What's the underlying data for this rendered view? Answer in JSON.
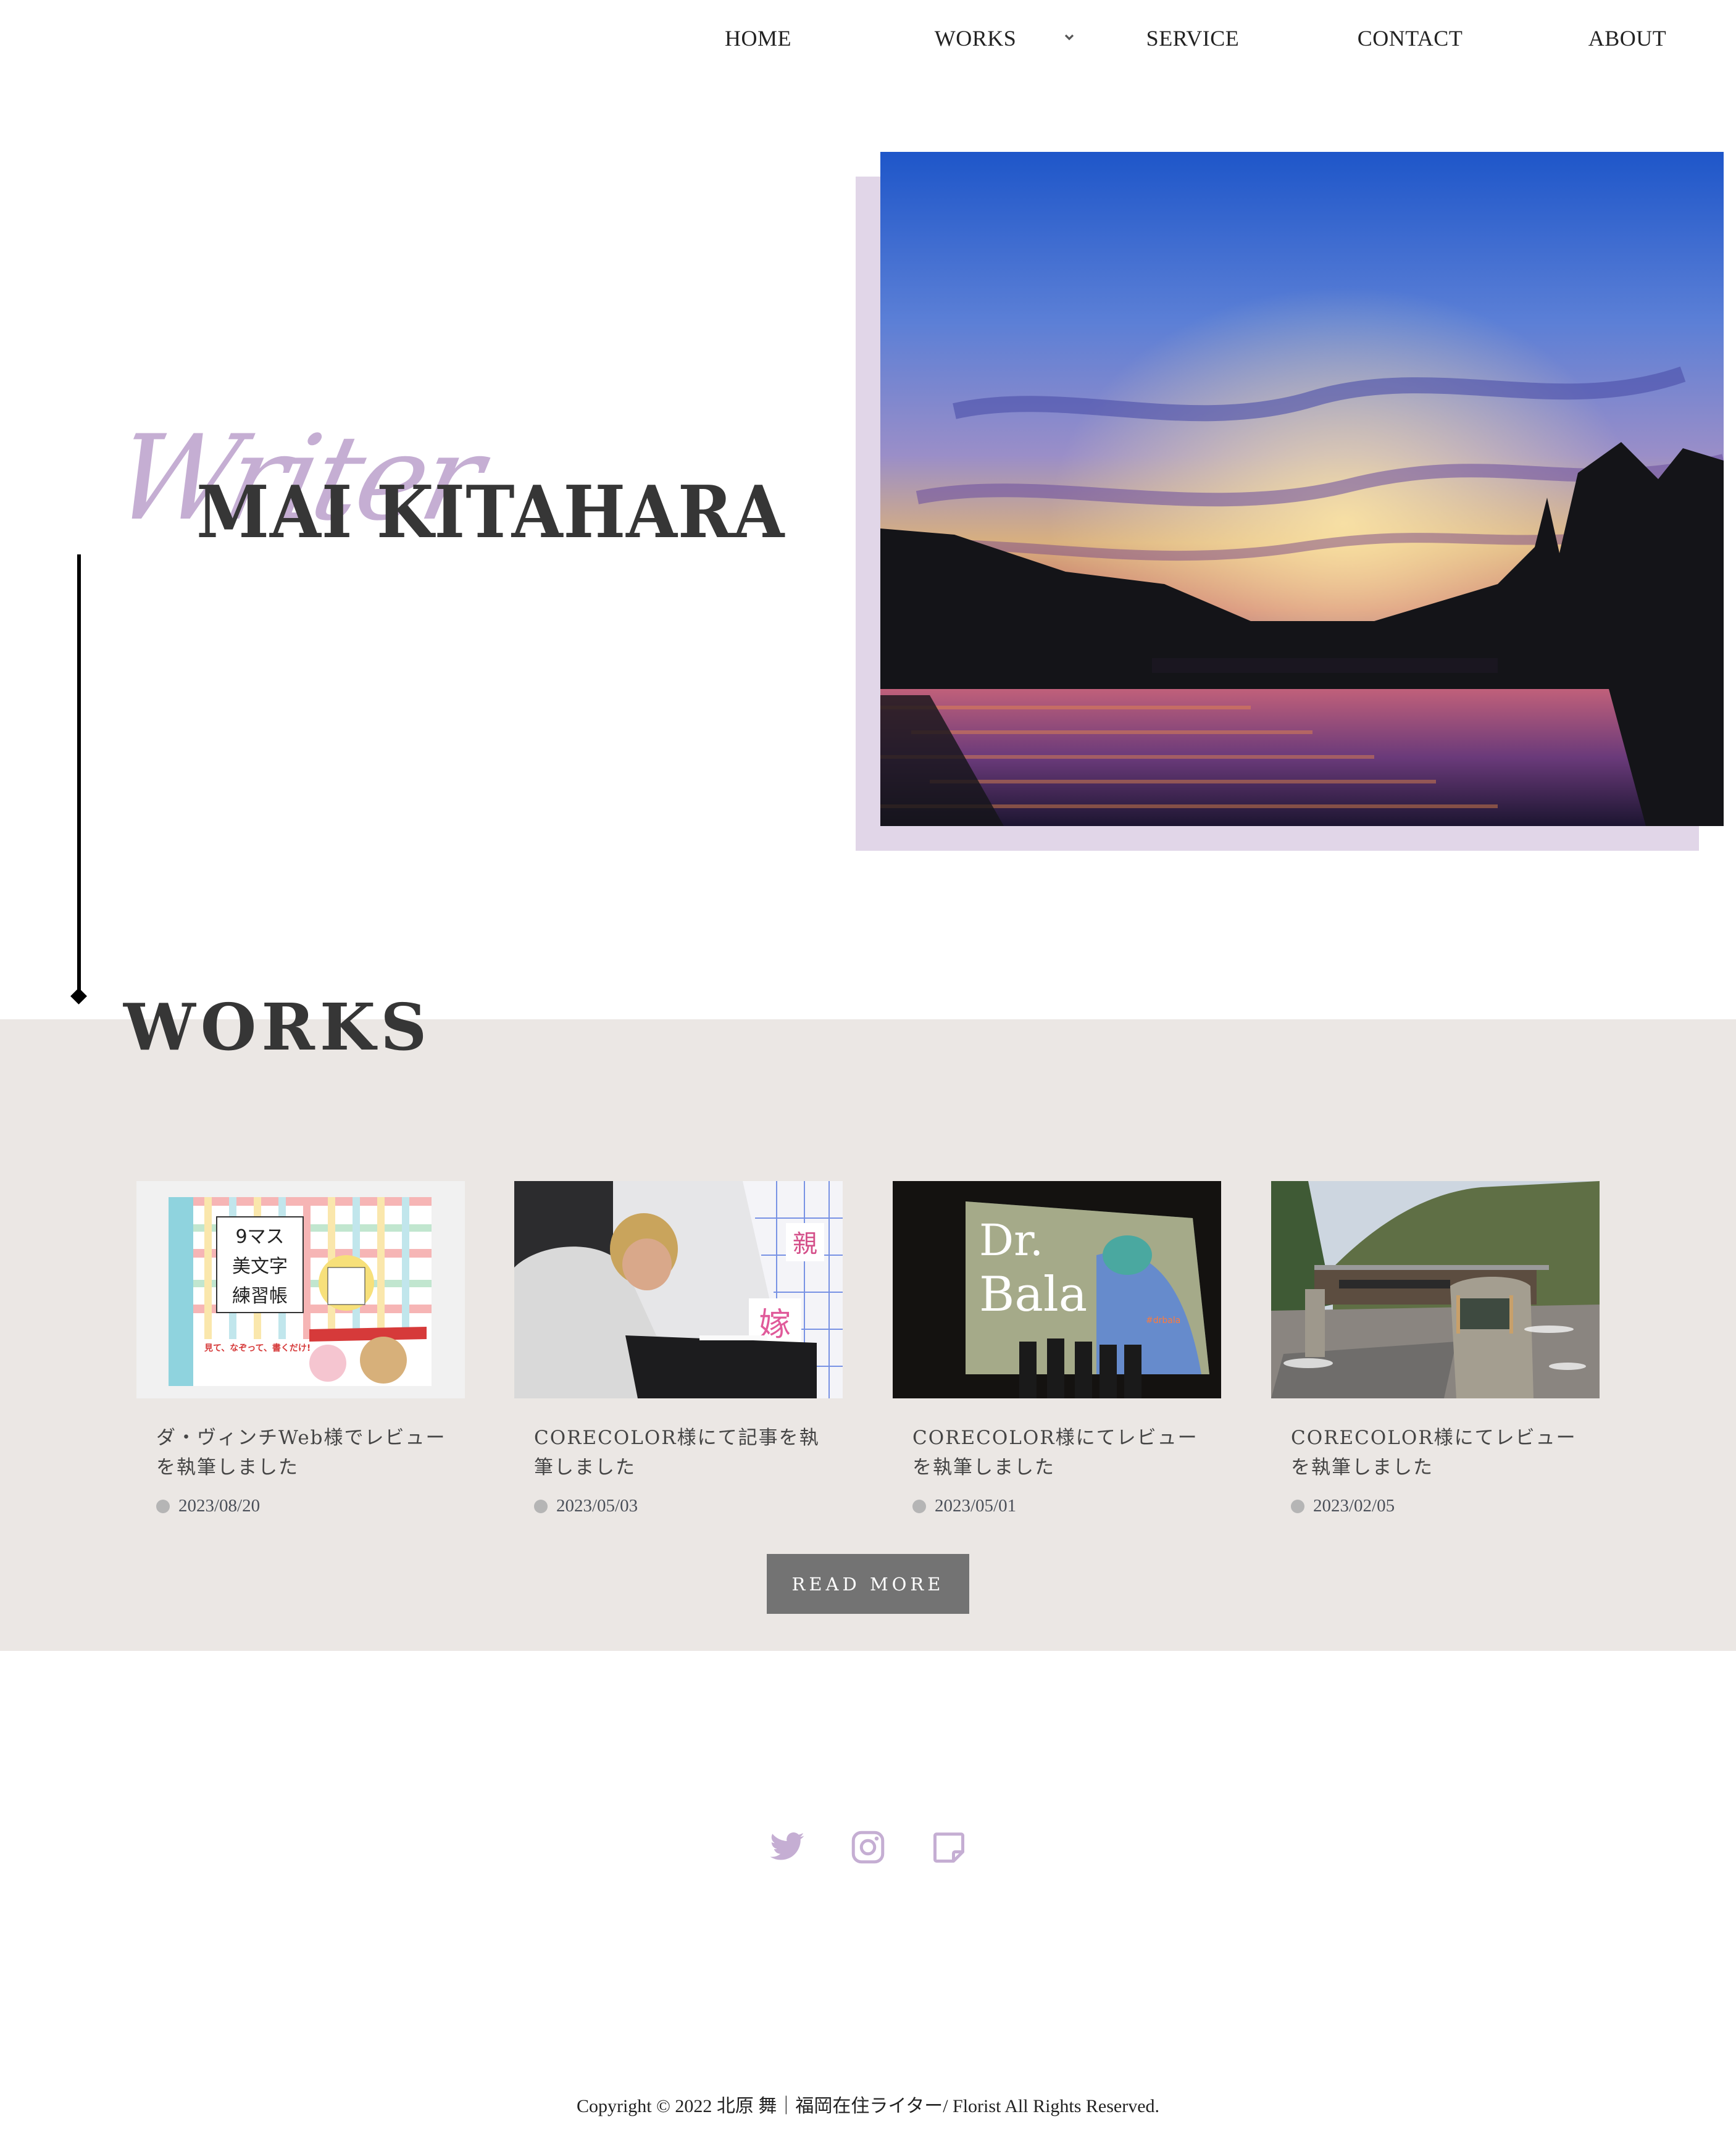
{
  "nav": {
    "items": [
      {
        "label": "HOME"
      },
      {
        "label": "WORKS",
        "has_dropdown": true
      },
      {
        "label": "SERVICE"
      },
      {
        "label": "CONTACT"
      },
      {
        "label": "ABOUT"
      }
    ]
  },
  "hero": {
    "script_label": "Writer",
    "name": "MAI KITAHARA",
    "photo_alt": "Sunset over river with city silhouette"
  },
  "works": {
    "title": "WORKS",
    "cards": [
      {
        "title": "ダ・ヴィンチWeb様でレビューを執筆しました",
        "date": "2023/08/20",
        "image": "book cover: 9マス美文字練習帳"
      },
      {
        "title": "CORECOLOR様にて記事を執筆しました",
        "date": "2023/05/03",
        "image": "calligrapher writing at desk with characters 親 嫁"
      },
      {
        "title": "CORECOLOR様にてレビューを執筆しました",
        "date": "2023/05/01",
        "image": "Dr. Bala film screening stage"
      },
      {
        "title": "CORECOLOR様にてレビューを執筆しました",
        "date": "2023/02/05",
        "image": "building with stone sign and mountains"
      }
    ],
    "read_more_label": "READ MORE"
  },
  "social": {
    "icons": [
      "twitter-icon",
      "instagram-icon",
      "note-icon"
    ],
    "color": "#c5aed3"
  },
  "footer": {
    "copyright": "Copyright © 2022 北原 舞｜福岡在住ライター/ Florist All Rights Reserved."
  },
  "colors": {
    "accent_lavender": "#c5aed3",
    "backdrop_lavender": "#e1d6e8",
    "works_band": "#ebe7e4",
    "button_gray": "#737373",
    "heading": "#363636"
  }
}
